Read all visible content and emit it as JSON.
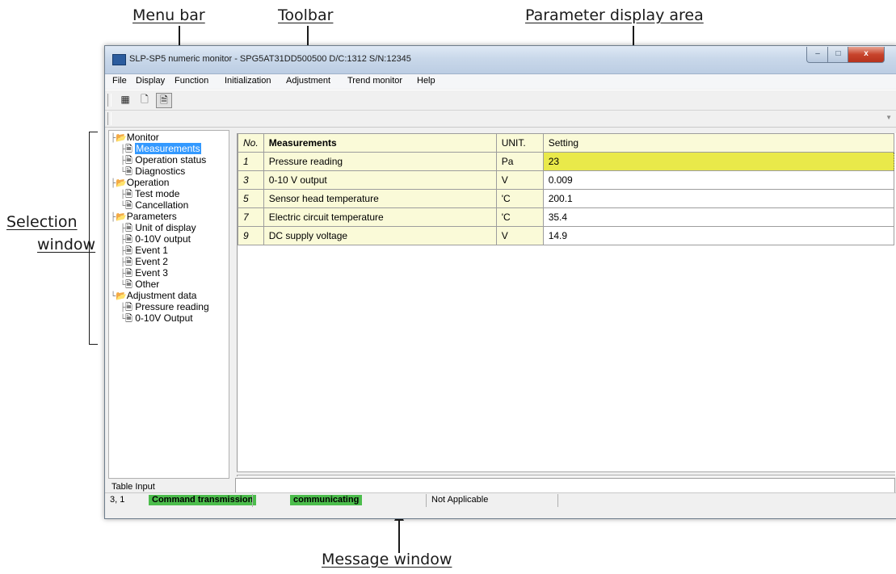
{
  "annotations": {
    "menu_bar": "Menu bar",
    "toolbar": "Toolbar",
    "parameter_display_area": "Parameter display area",
    "selection_window_line1": "Selection",
    "selection_window_line2": "window",
    "message_window": "Message window"
  },
  "window": {
    "title": "SLP-SP5 numeric monitor - SPG5AT31DD500500 D/C:1312 S/N:12345",
    "controls": {
      "minimize": "–",
      "maximize": "□",
      "close": "x"
    }
  },
  "menu": {
    "items": [
      "File",
      "Display",
      "Function",
      "Initialization",
      "Adjustment",
      "Trend monitor",
      "Help"
    ]
  },
  "toolbar": {
    "icons": [
      "table-view-icon",
      "document-icon",
      "document-list-icon"
    ]
  },
  "tree": {
    "groups": [
      {
        "label": "Monitor",
        "children": [
          "Measurements",
          "Operation status",
          "Diagnostics"
        ]
      },
      {
        "label": "Operation",
        "children": [
          "Test mode",
          "Cancellation"
        ]
      },
      {
        "label": "Parameters",
        "children": [
          "Unit of display",
          "0-10V output",
          "Event 1",
          "Event 2",
          "Event 3",
          "Other"
        ]
      },
      {
        "label": "Adjustment data",
        "children": [
          "Pressure reading",
          "0-10V Output"
        ]
      }
    ],
    "selected": "Measurements"
  },
  "table": {
    "headers": [
      "No.",
      "Measurements",
      "UNIT.",
      "Setting"
    ],
    "rows": [
      {
        "no": "1",
        "name": "Pressure reading",
        "unit": "Pa",
        "setting": "23"
      },
      {
        "no": "3",
        "name": "0-10 V output",
        "unit": "V",
        "setting": "0.009"
      },
      {
        "no": "5",
        "name": "Sensor head temperature",
        "unit": "'C",
        "setting": "200.1"
      },
      {
        "no": "7",
        "name": "Electric circuit temperature",
        "unit": "'C",
        "setting": "35.4"
      },
      {
        "no": "9",
        "name": "DC supply voltage",
        "unit": "V",
        "setting": "14.9"
      }
    ]
  },
  "message": {
    "label": "Table Input",
    "input_value": ""
  },
  "status": {
    "position": "3, 1",
    "transmission": "Command transmission",
    "communicating": "communicating",
    "applicable": "Not Applicable"
  },
  "colors": {
    "highlight_cell": "#e9e94a",
    "status_green": "#4cbd4c",
    "selection": "#3399ff"
  }
}
